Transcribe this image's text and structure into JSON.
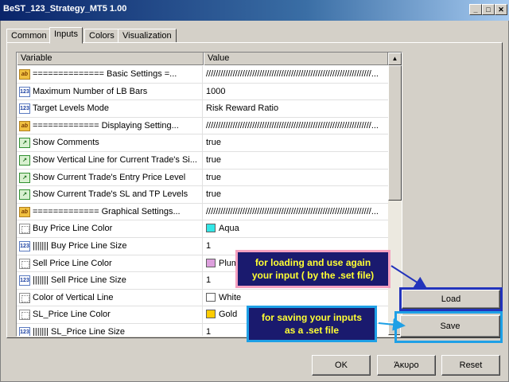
{
  "window": {
    "title": "BeST_123_Strategy_MT5 1.00"
  },
  "tabs": [
    {
      "label": "Common"
    },
    {
      "label": "Inputs"
    },
    {
      "label": "Colors"
    },
    {
      "label": "Visualization"
    }
  ],
  "active_tab": "Inputs",
  "grid": {
    "columns": [
      "Variable",
      "Value"
    ],
    "rows": [
      {
        "icon": "ab",
        "variable": "============== Basic Settings =...",
        "value": "////////////////////////////////////////////////////////////////////..."
      },
      {
        "icon": "123",
        "variable": "Maximum Number of LB Bars",
        "value": "1000"
      },
      {
        "icon": "123",
        "variable": "Target Levels Mode",
        "value": "Risk Reward Ratio"
      },
      {
        "icon": "ab",
        "variable": "============= Displaying Setting...",
        "value": "////////////////////////////////////////////////////////////////////..."
      },
      {
        "icon": "bool",
        "variable": "Show Comments",
        "value": "true"
      },
      {
        "icon": "bool",
        "variable": "Show Vertical Line for Current Trade's Si...",
        "value": "true"
      },
      {
        "icon": "bool",
        "variable": "Show Current Trade's Entry Price Level",
        "value": "true"
      },
      {
        "icon": "bool",
        "variable": "Show Current Trade's SL and TP Levels",
        "value": "true"
      },
      {
        "icon": "ab",
        "variable": "============= Graphical Settings...",
        "value": "////////////////////////////////////////////////////////////////////..."
      },
      {
        "icon": "color",
        "variable": "Buy Price Line Color",
        "value": "Aqua",
        "swatch": "#33e6e6"
      },
      {
        "icon": "123",
        "variable": "||||||| Buy Price Line Size",
        "value": "1"
      },
      {
        "icon": "color",
        "variable": "Sell Price Line Color",
        "value": "Plum",
        "swatch": "#dda0dd"
      },
      {
        "icon": "123",
        "variable": "||||||| Sell Price Line Size",
        "value": "1"
      },
      {
        "icon": "color",
        "variable": "Color of Vertical Line",
        "value": "White",
        "swatch": "#ffffff"
      },
      {
        "icon": "color",
        "variable": "SL_Price Line Color",
        "value": "Gold",
        "swatch": "#ffcc00"
      },
      {
        "icon": "123",
        "variable": "||||||| SL_Price Line Size",
        "value": "1"
      }
    ]
  },
  "buttons": {
    "load": "Load",
    "save": "Save",
    "ok": "OK",
    "cancel": "Άκυρο",
    "reset": "Reset"
  },
  "annotations": {
    "load_line1": "for loading and use again",
    "load_line2": "your input ( by the .set file)",
    "save_line1": "for saving your inputs",
    "save_line2": "as a    .set file"
  }
}
